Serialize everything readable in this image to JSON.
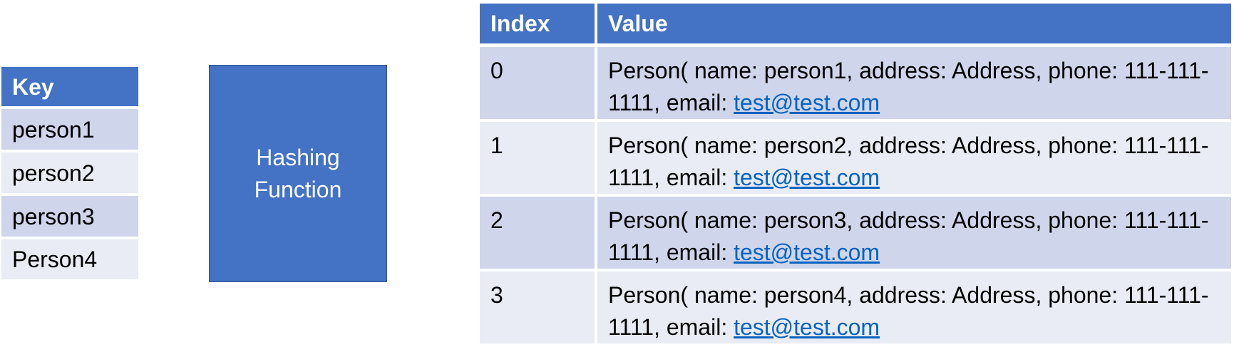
{
  "key_table": {
    "header": "Key",
    "keys": [
      "person1",
      "person2",
      "person3",
      "Person4"
    ]
  },
  "hashing_function": {
    "label": "Hashing\nFunction"
  },
  "hash_table": {
    "headers": {
      "index": "Index",
      "value": "Value"
    },
    "rows": [
      {
        "index": "0",
        "value_text": "Person( name: person1, address: Address, phone: 111-111-1111, email: ",
        "email": "test@test.com"
      },
      {
        "index": "1",
        "value_text": "Person( name: person2, address: Address, phone: 111-111-1111, email: ",
        "email": "test@test.com"
      },
      {
        "index": "2",
        "value_text": "Person( name: person3, address: Address, phone: 111-111-1111, email: ",
        "email": "test@test.com"
      },
      {
        "index": "3",
        "value_text": "Person( name: person4, address: Address, phone: 111-111-1111, email: ",
        "email": "test@test.com"
      }
    ]
  },
  "colors": {
    "header_fill": "#4472c4",
    "row_dark": "#cfd5ea",
    "row_light": "#e9ebf5",
    "hash_box_fill": "#4472c4",
    "hash_box_border": "#2f528f",
    "link": "#0563c1"
  }
}
